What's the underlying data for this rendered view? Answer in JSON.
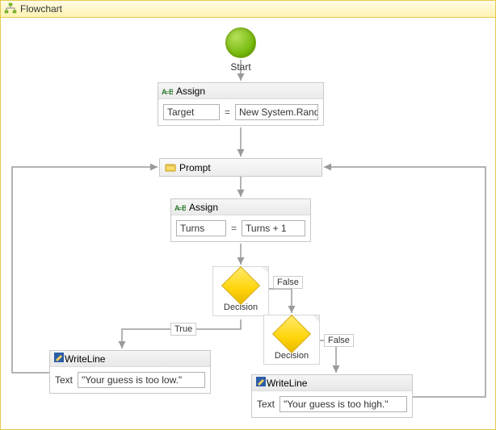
{
  "window": {
    "title": "Flowchart"
  },
  "start": {
    "label": "Start"
  },
  "assign1": {
    "title": "Assign",
    "left_value": "Target",
    "right_value": "New System.Rando"
  },
  "prompt": {
    "title": "Prompt"
  },
  "assign2": {
    "title": "Assign",
    "left_value": "Turns",
    "right_value": "Turns + 1"
  },
  "decision1": {
    "label": "Decision"
  },
  "decision2": {
    "label": "Decision"
  },
  "branches": {
    "true_label": "True",
    "false1_label": "False",
    "false2_label": "False"
  },
  "writeline1": {
    "title": "WriteLine",
    "text_label": "Text",
    "text_value": "\"Your guess is too low.\""
  },
  "writeline2": {
    "title": "WriteLine",
    "text_label": "Text",
    "text_value": "\"Your guess is too high.\""
  },
  "eq": "="
}
